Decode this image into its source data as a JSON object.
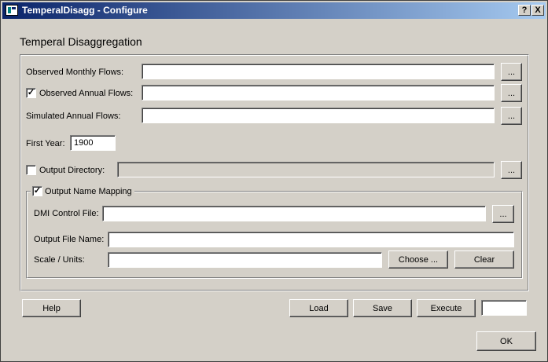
{
  "window": {
    "title": "TemperalDisagg - Configure",
    "help_glyph": "?",
    "close_glyph": "X"
  },
  "heading": "Temperal Disaggregation",
  "fields": {
    "observed_monthly": {
      "label": "Observed Monthly Flows:",
      "value": ""
    },
    "observed_annual": {
      "label": "Observed Annual Flows:",
      "value": "",
      "checked": true
    },
    "simulated_annual": {
      "label": "Simulated Annual Flows:",
      "value": ""
    },
    "first_year": {
      "label": "First Year:",
      "value": "1900"
    },
    "output_directory": {
      "label": "Output Directory:",
      "value": "",
      "checked": false
    }
  },
  "browse_label": "...",
  "name_mapping": {
    "legend": "Output Name Mapping",
    "checked": true,
    "dmi_control_file": {
      "label": "DMI Control File:",
      "value": ""
    },
    "output_file_name": {
      "label": "Output File Name:",
      "value": ""
    },
    "scale_units": {
      "label": "Scale / Units:",
      "value": ""
    },
    "choose_label": "Choose ...",
    "clear_label": "Clear"
  },
  "buttons": {
    "help": "Help",
    "load": "Load",
    "save": "Save",
    "execute": "Execute",
    "ok": "OK"
  },
  "status_value": ""
}
